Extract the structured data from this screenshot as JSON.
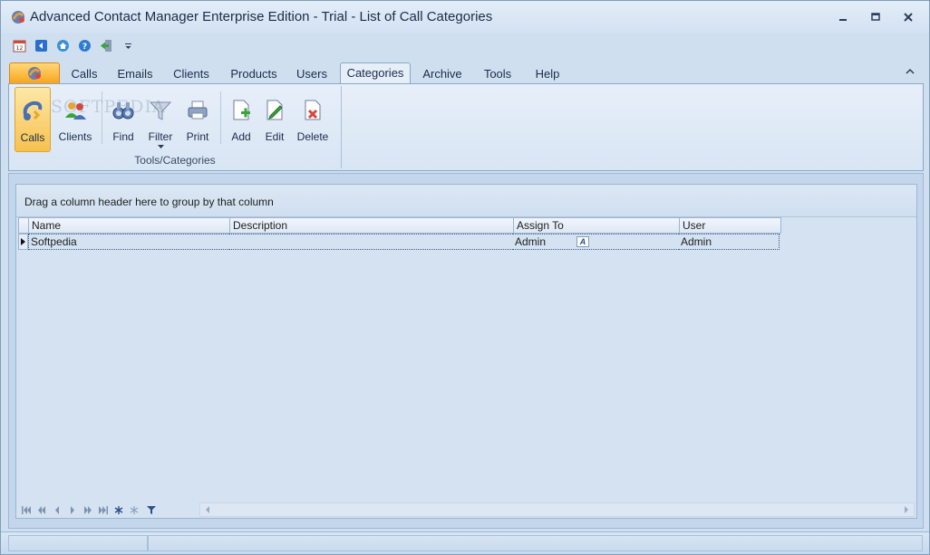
{
  "window": {
    "title": "Advanced Contact Manager Enterprise Edition - Trial - List of Call Categories"
  },
  "quick_access": [
    {
      "icon": "calendar-icon"
    },
    {
      "icon": "back-icon"
    },
    {
      "icon": "home-icon"
    },
    {
      "icon": "help-icon"
    },
    {
      "icon": "exit-icon"
    },
    {
      "icon": "customize-dropdown-icon"
    }
  ],
  "ribbon": {
    "tabs": [
      "Calls",
      "Emails",
      "Clients",
      "Products",
      "Users",
      "Categories",
      "Archive",
      "Tools",
      "Help"
    ],
    "active_tab": "Categories",
    "buttons": {
      "calls": "Calls",
      "clients": "Clients",
      "find": "Find",
      "filter": "Filter",
      "print": "Print",
      "add": "Add",
      "edit": "Edit",
      "delete": "Delete"
    },
    "group_label": "Tools/Categories",
    "watermark": "SOFTPEDIA"
  },
  "grid": {
    "group_hint": "Drag a column header here to group by that column",
    "columns": [
      "Name",
      "Description",
      "Assign To",
      "User"
    ],
    "rows": [
      {
        "name": "Softpedia",
        "description": "",
        "assign_to": "Admin",
        "user": "Admin"
      }
    ],
    "description_editor_icon": "A"
  },
  "colors": {
    "accent": "#f9a51a",
    "window_bg": "#cfdff0",
    "title_text": "#1c2b4a"
  }
}
